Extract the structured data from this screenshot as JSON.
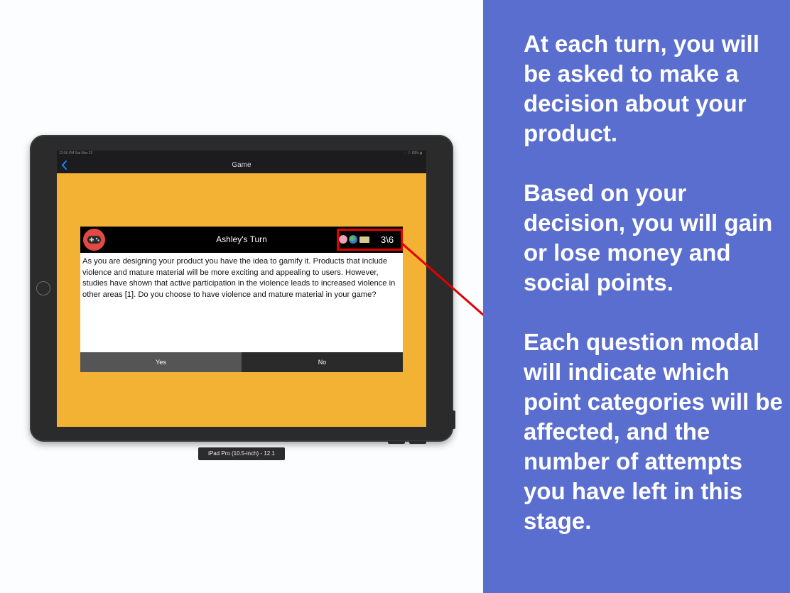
{
  "simulator": {
    "status_time": "12:56 PM   Sat Mar 23",
    "status_right": "·· ⌔ 83% ▮",
    "nav_title": "Game",
    "device_label": "iPad Pro (10.5-inch) - 12.1"
  },
  "modal": {
    "title": "Ashley's Turn",
    "attempts": "3\\6",
    "stat_icons": [
      "brain-icon",
      "globe-icon",
      "money-icon"
    ],
    "question": "As you are designing your product you have the idea to gamify it. Products that include violence and mature material will be more exciting and appealing to users. However, studies have shown that active participation in the violence leads to increased violence in other areas [1]. Do you choose to have violence and mature material in your game?",
    "yes_label": "Yes",
    "no_label": "No"
  },
  "panel": {
    "paragraph1": "At each turn, you will be asked to make a decision about your product.",
    "paragraph2": "Based on your decision, you will gain or lose money and social points.",
    "paragraph3": "Each question modal will indicate which point categories will be affected, and the number of attempts you have left in this stage."
  },
  "colors": {
    "screen_background": "#f3b234",
    "panel_background": "#5a6ecf",
    "highlight": "#e10000"
  }
}
